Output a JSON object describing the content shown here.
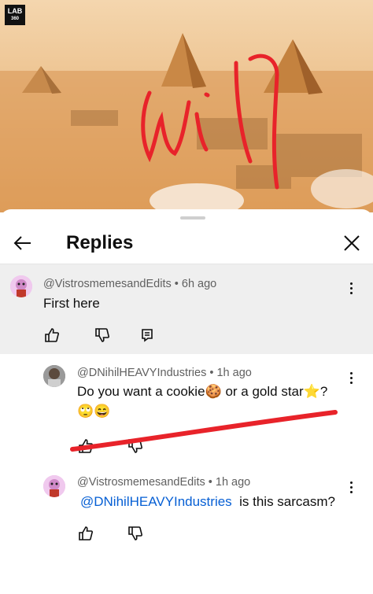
{
  "video": {
    "logo_line1": "LAB",
    "logo_line2": "360",
    "scribble_text": "wil"
  },
  "sheet": {
    "title": "Replies"
  },
  "comments": [
    {
      "author": "@VistrosmemesandEdits",
      "time": "6h ago",
      "text": "First here"
    },
    {
      "author": "@DNihilHEAVYIndustries",
      "time": "1h ago",
      "text_line1_a": "Do you want a cookie",
      "text_line1_b": "or a gold star",
      "text_line1_c": "?",
      "emoji_cookie": "🍪",
      "emoji_star": "⭐",
      "emoji_line2": "🙄😄"
    },
    {
      "author": "@VistrosmemesandEdits",
      "time": "1h ago",
      "mention": "@DNihilHEAVYIndustries",
      "text": "is this sarcasm?"
    }
  ],
  "separator": "•",
  "icons": {
    "back": "arrow-left-icon",
    "close": "close-icon",
    "like": "thumbs-up-icon",
    "dislike": "thumbs-down-icon",
    "reply": "reply-icon",
    "more": "more-vert-icon"
  },
  "colors": {
    "scribble": "#e8232a",
    "mention": "#065fd4",
    "highlight": "#efefef"
  }
}
